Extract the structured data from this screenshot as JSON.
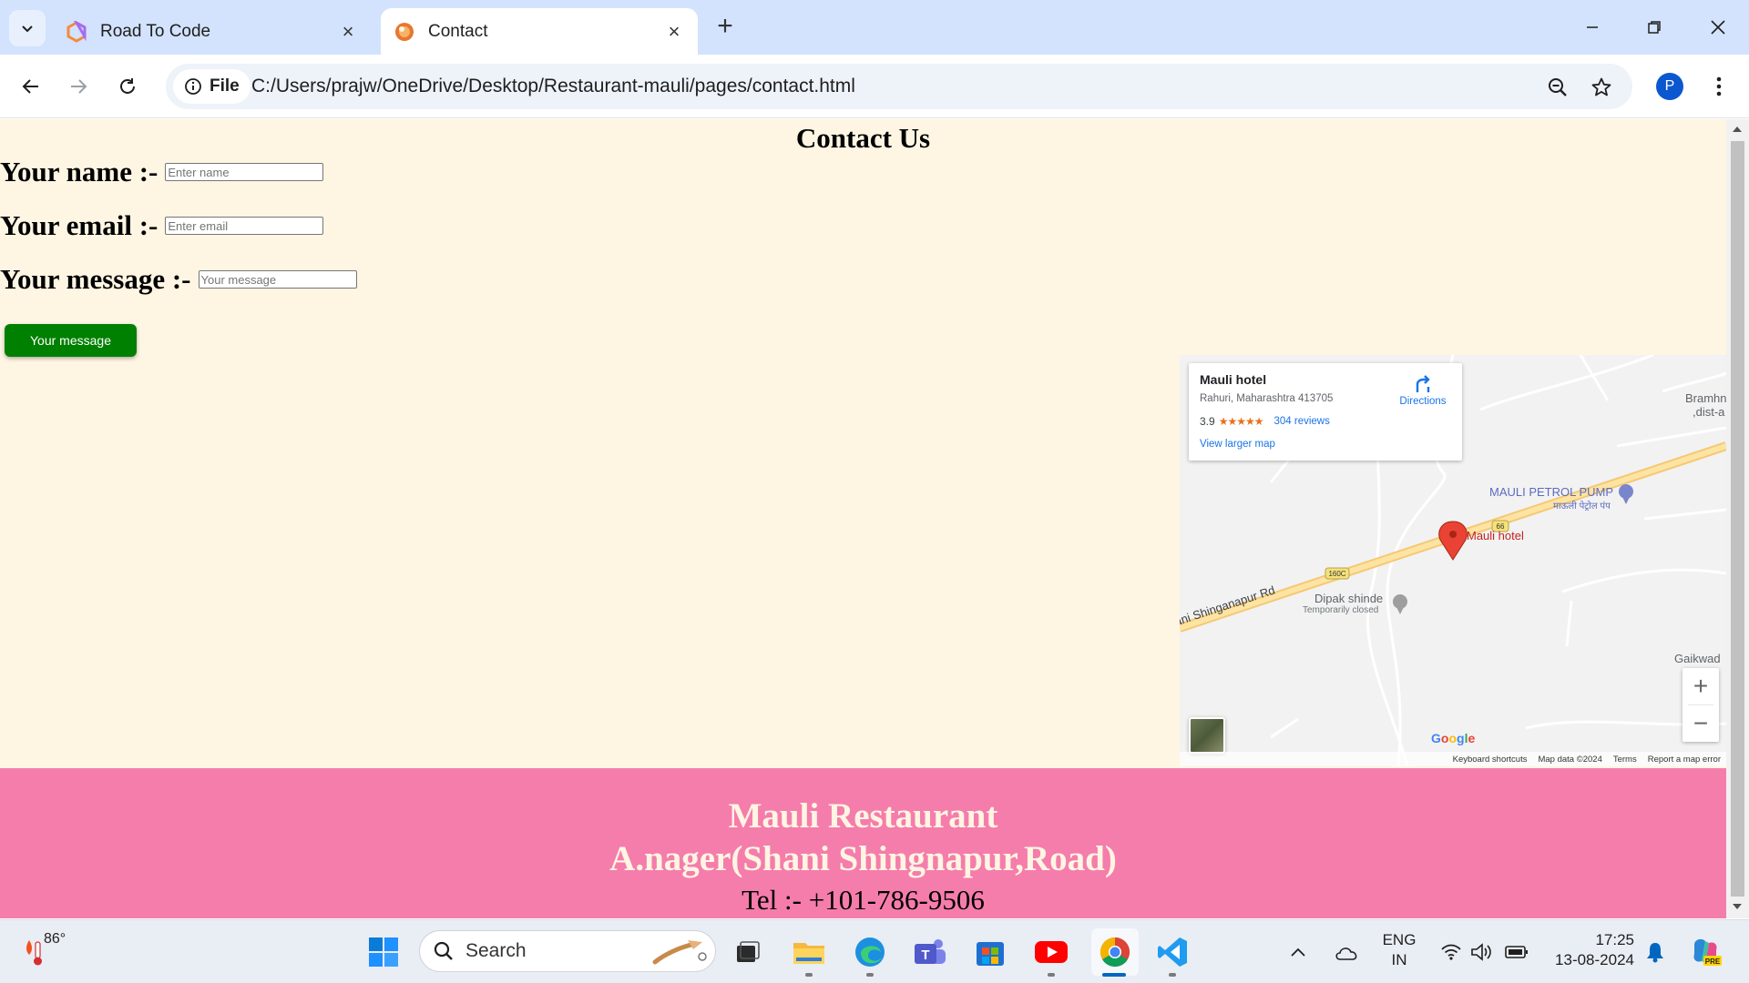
{
  "browser": {
    "tabs": [
      {
        "title": "Road To Code",
        "active": false
      },
      {
        "title": "Contact",
        "active": true
      }
    ],
    "site_chip": "File",
    "url": "C:/Users/prajw/OneDrive/Desktop/Restaurant-mauli/pages/contact.html",
    "profile_initial": "P"
  },
  "page": {
    "title": "Contact Us",
    "form": {
      "name_label": "Your name :-",
      "name_placeholder": "Enter name",
      "email_label": "Your email :-",
      "email_placeholder": "Enter email",
      "message_label": "Your message :-",
      "message_placeholder": "Your message",
      "submit_label": "Your message"
    },
    "map": {
      "place_name": "Mauli hotel",
      "address": "Rahuri, Maharashtra 413705",
      "rating": "3.9",
      "stars": "★★★★★",
      "reviews": "304 reviews",
      "directions": "Directions",
      "larger_map": "View larger map",
      "labels": {
        "bramhni": "Bramhn",
        "bramhni2": ",dist-a",
        "petrol_pump": "MAULI PETROL PUMP",
        "petrol_pump_local": "माऊली पेट्रोल पंप",
        "marker": "Mauli hotel",
        "dipak": "Dipak shinde",
        "dipak_status": "Temporarily closed",
        "road": "ani Shinganapur Rd",
        "gaikwad": "Gaikwad",
        "route_160c": "160C",
        "route_66": "66"
      },
      "google": "Google",
      "footer": [
        "Keyboard shortcuts",
        "Map data ©2024",
        "Terms",
        "Report a map error"
      ],
      "zoom_in": "+",
      "zoom_out": "−"
    },
    "footer": {
      "name": "Mauli Restaurant",
      "address": "A.nager(Shani Shingnapur,Road)",
      "tel": "Tel :- +101-786-9506"
    }
  },
  "taskbar": {
    "weather_temp": "86°",
    "search_label": "Search",
    "lang_top": "ENG",
    "lang_bottom": "IN",
    "time": "17:25",
    "date": "13-08-2024"
  },
  "colors": {
    "page_bg": "#fef5e3",
    "footer_bg": "#f57dab",
    "submit_bg": "#008000",
    "tabbar_bg": "#d3e3fd"
  }
}
